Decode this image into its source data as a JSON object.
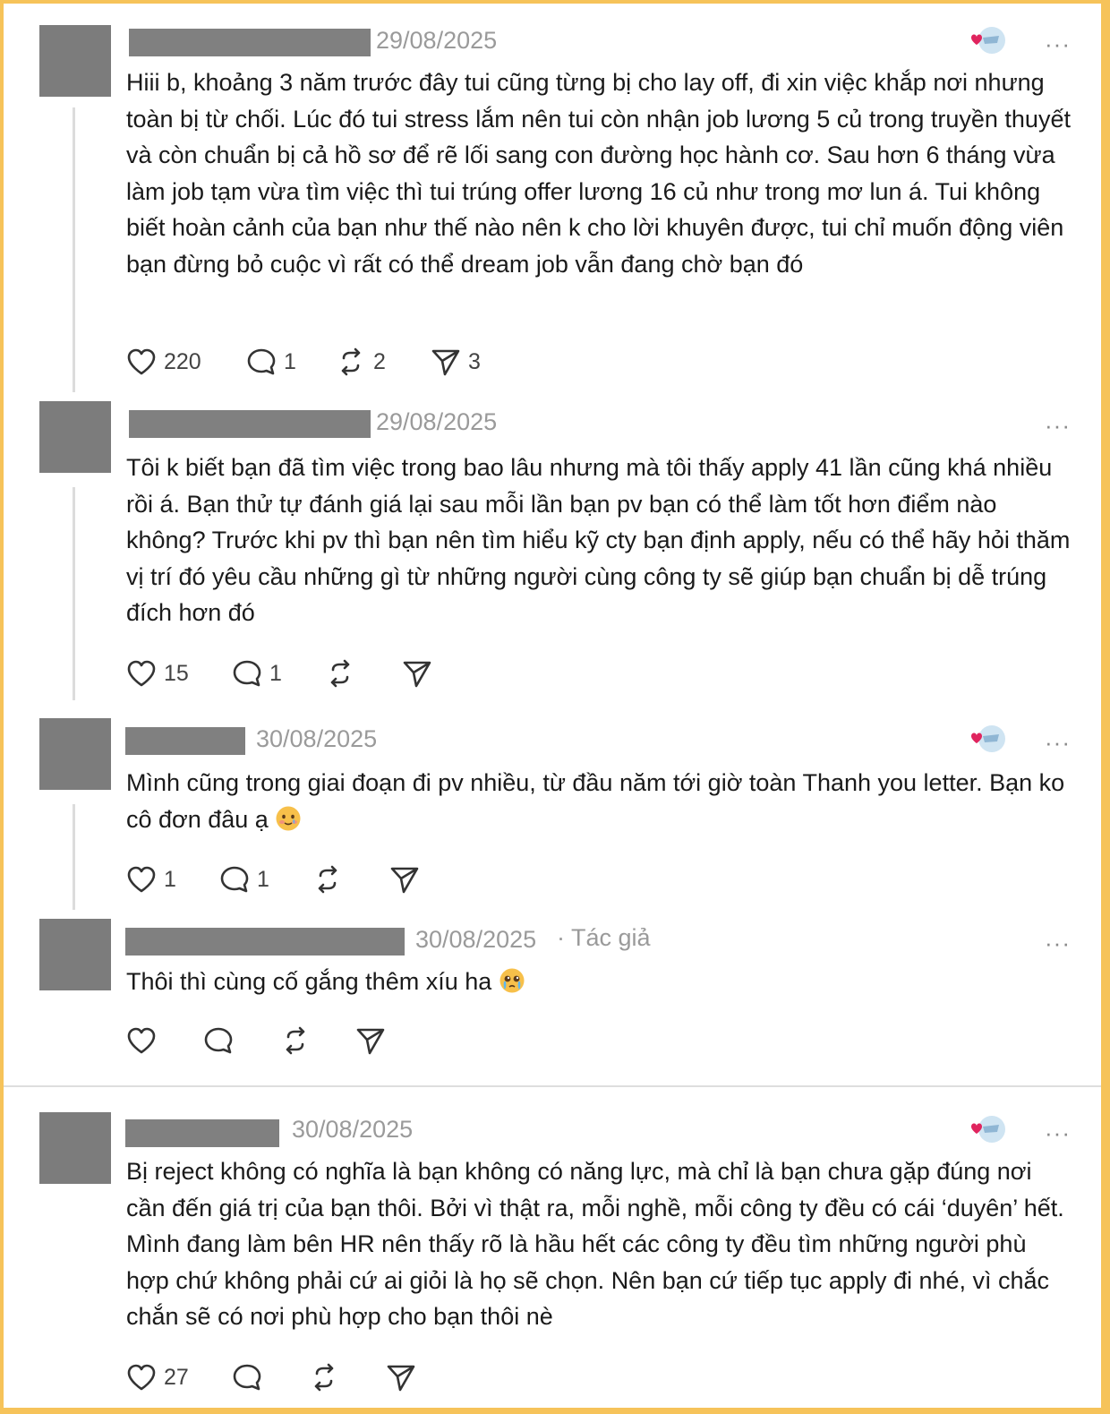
{
  "posts": [
    {
      "date": "29/08/2025",
      "author_tag": "",
      "text": "Hiii b, khoảng 3 năm trước đây tui cũng từng bị cho lay off, đi xin việc khắp nơi nhưng toàn bị từ chối. Lúc đó tui stress lắm nên tui còn nhận job lương 5 củ trong truyền thuyết và còn chuẩn bị cả hồ sơ để rẽ lối sang con đường học hành cơ. Sau hơn 6 tháng vừa làm job tạm vừa tìm việc thì tui trúng offer lương 16 củ như trong mơ lun á. Tui không biết hoàn cảnh của bạn như thế nào nên k cho lời khuyên được, tui chỉ muốn động viên bạn đừng bỏ cuộc vì rất có thể dream job vẫn đang chờ bạn đó",
      "emoji": "",
      "likes": "220",
      "replies": "1",
      "reposts": "2",
      "shares": "3"
    },
    {
      "date": "29/08/2025",
      "author_tag": "",
      "text": "Tôi k biết bạn đã tìm việc trong bao lâu nhưng mà tôi thấy apply 41 lần cũng khá nhiều rồi á. Bạn thử tự đánh giá lại sau mỗi lần bạn pv bạn có thể làm tốt hơn điểm nào không? Trước khi pv thì bạn nên tìm hiểu kỹ cty bạn định apply, nếu có thể hãy hỏi thăm vị trí đó yêu cầu những gì từ những người cùng công ty sẽ giúp bạn chuẩn bị dễ trúng đích hơn đó",
      "emoji": "",
      "likes": "15",
      "replies": "1",
      "reposts": "",
      "shares": ""
    },
    {
      "date": "30/08/2025",
      "author_tag": "",
      "text": "Mình cũng trong giai đoạn đi pv nhiều, từ đầu năm tới giờ toàn Thanh you letter. Bạn ko cô đơn đâu ạ",
      "emoji": "smiling-face-with-tear",
      "likes": "1",
      "replies": "1",
      "reposts": "",
      "shares": ""
    },
    {
      "date": "30/08/2025",
      "author_tag": "· Tác giả",
      "text": "Thôi thì cùng cố gắng thêm xíu ha",
      "emoji": "pleading-face-with-tears",
      "likes": "",
      "replies": "",
      "reposts": "",
      "shares": ""
    },
    {
      "date": "30/08/2025",
      "author_tag": "",
      "text": "Bị reject không có nghĩa là bạn không có năng lực, mà chỉ là bạn chưa gặp đúng nơi cần đến giá trị của bạn thôi. Bởi vì thật ra, mỗi nghề, mỗi công ty đều có cái ‘duyên’ hết. Mình đang làm bên HR nên thấy rõ là hầu hết các công ty đều tìm những người phù hợp chứ không phải cứ ai giỏi là họ sẽ chọn. Nên bạn cứ tiếp tục apply đi nhé, vì chắc chắn sẽ có nơi phù hợp cho bạn thôi nè",
      "emoji": "",
      "likes": "27",
      "replies": "",
      "reposts": "",
      "shares": ""
    }
  ],
  "icons": {
    "like": "heart-icon",
    "reply": "comment-icon",
    "repost": "repost-icon",
    "share": "send-icon",
    "more": "more-icon",
    "liked_by_author": "author-liked-badge"
  },
  "more_label": "···",
  "colors": {
    "frame": "#f6c35a",
    "muted_text": "#9a9a9a",
    "redaction": "#808080",
    "heart_badge": "#e0245e"
  }
}
